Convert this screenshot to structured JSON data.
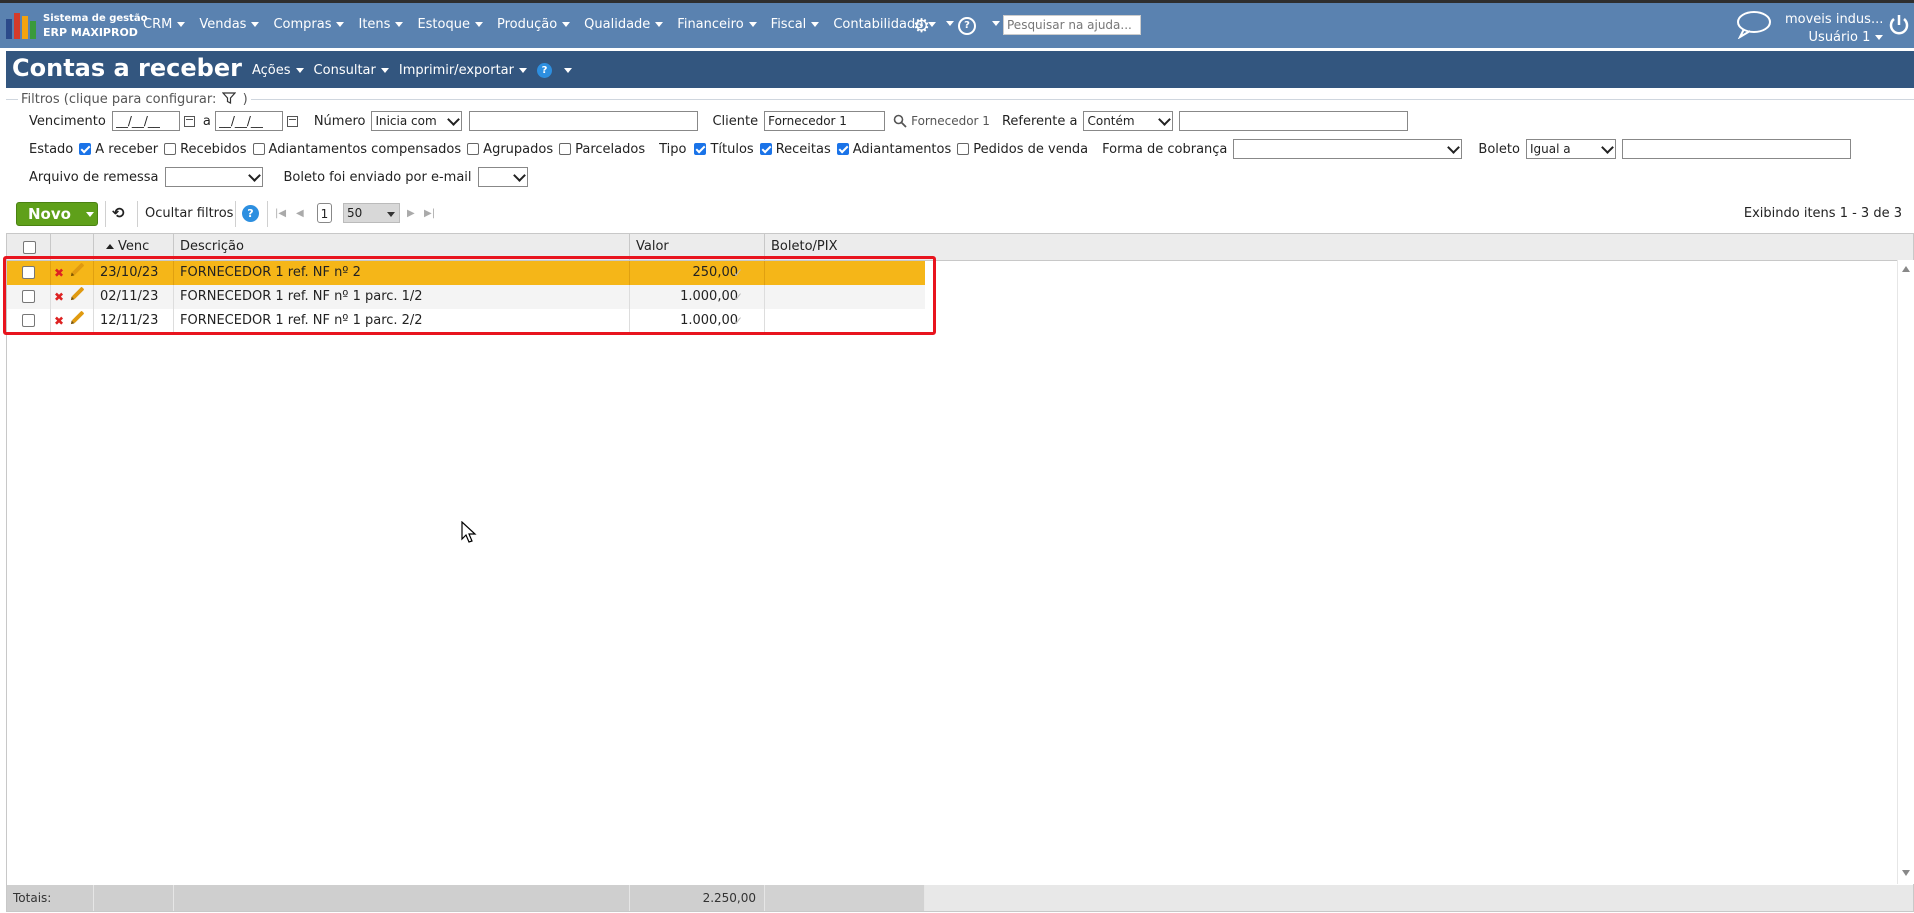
{
  "app": {
    "logo_line1": "Sistema de gestão",
    "logo_line2": "ERP MAXIPROD",
    "brand_colors": [
      "#2b4a8a",
      "#d43b2a",
      "#f2a30f",
      "#3a9a3a"
    ]
  },
  "top_menu": {
    "items": [
      "CRM",
      "Vendas",
      "Compras",
      "Itens",
      "Estoque",
      "Produção",
      "Qualidade",
      "Financeiro",
      "Fiscal",
      "Contabilidade"
    ],
    "settings_icon": "gear-icon",
    "help_icon": "question-icon",
    "search_placeholder": "Pesquisar na ajuda...",
    "account_name": "moveis indus...",
    "account_user": "Usuário 1"
  },
  "page": {
    "title": "Contas a receber",
    "menu": [
      "Ações",
      "Consultar",
      "Imprimir/exportar"
    ],
    "help_label": "?"
  },
  "filters": {
    "legend": "Filtros (clique para configurar:",
    "legend_close": ")",
    "vencimento_label": "Vencimento",
    "date_from": "__/__/__",
    "date_sep": "a",
    "date_to": "__/__/__",
    "numero_label": "Número",
    "numero_mode": "Inicia com",
    "numero_value": "",
    "cliente_label": "Cliente",
    "cliente_value": "Fornecedor 1",
    "cliente_link": "Fornecedor 1",
    "referente_label": "Referente a",
    "referente_mode": "Contém",
    "referente_value": "",
    "estado_label": "Estado",
    "estado_options": [
      {
        "label": "A receber",
        "checked": true
      },
      {
        "label": "Recebidos",
        "checked": false
      },
      {
        "label": "Adiantamentos compensados",
        "checked": false
      },
      {
        "label": "Agrupados",
        "checked": false
      },
      {
        "label": "Parcelados",
        "checked": false
      }
    ],
    "tipo_label": "Tipo",
    "tipo_options": [
      {
        "label": "Títulos",
        "checked": true
      },
      {
        "label": "Receitas",
        "checked": true
      },
      {
        "label": "Adiantamentos",
        "checked": true
      },
      {
        "label": "Pedidos de venda",
        "checked": false
      }
    ],
    "forma_label": "Forma de cobrança",
    "forma_value": "",
    "boleto_label": "Boleto",
    "boleto_mode": "Igual a",
    "boleto_value": "",
    "remessa_label": "Arquivo de remessa",
    "remessa_value": "",
    "email_label": "Boleto foi enviado por e-mail",
    "email_value": ""
  },
  "toolbar": {
    "novo_label": "Novo",
    "ocultar_label": "Ocultar filtros",
    "help_label": "?",
    "page_number": "1",
    "page_size": "50",
    "showing_text": "Exibindo itens 1 - 3 de 3"
  },
  "table": {
    "columns": [
      "Venc",
      "Descrição",
      "Valor",
      "Boleto/PIX"
    ],
    "rows": [
      {
        "venc": "23/10/23",
        "descricao": "FORNECEDOR 1 ref. NF nº 2",
        "valor": "250,00",
        "boleto": "",
        "selected": true
      },
      {
        "venc": "02/11/23",
        "descricao": "FORNECEDOR 1 ref. NF nº 1 parc. 1/2",
        "valor": "1.000,00",
        "boleto": "",
        "selected": false
      },
      {
        "venc": "12/11/23",
        "descricao": "FORNECEDOR 1 ref. NF nº 1 parc. 2/2",
        "valor": "1.000,00",
        "boleto": "",
        "selected": false
      }
    ],
    "totals_label": "Totais:",
    "totals_value": "2.250,00",
    "highlight_color": "#e8141e"
  }
}
